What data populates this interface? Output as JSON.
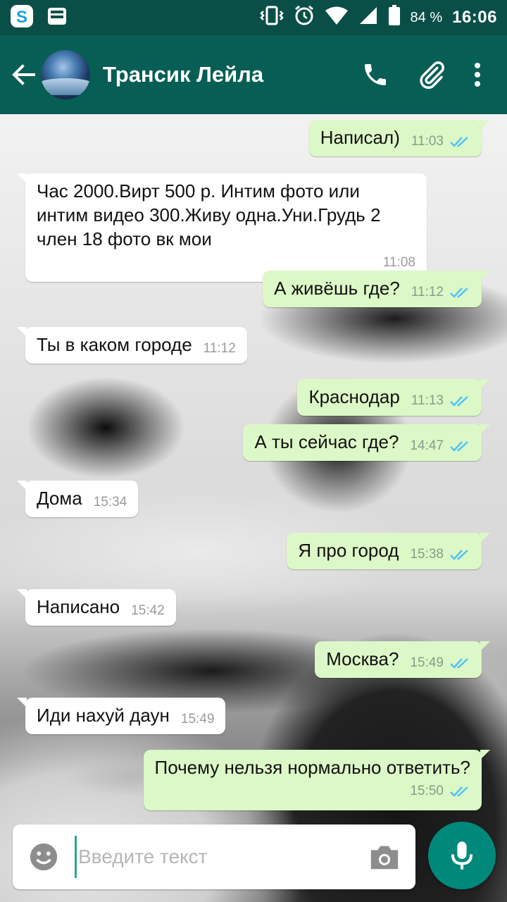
{
  "status_bar": {
    "battery_percent": "84 %",
    "time": "16:06"
  },
  "toolbar": {
    "contact_name": "Трансик Лейла"
  },
  "messages": [
    {
      "direction": "out",
      "text": "Написал)",
      "time": "11:03"
    },
    {
      "direction": "in",
      "text": "Час 2000.Вирт 500 р. Интим фото или интим видео 300.Живу одна.Уни.Грудь 2 член 18 фото вк мои",
      "time": "11:08"
    },
    {
      "direction": "out",
      "text": "А живёшь где?",
      "time": "11:12"
    },
    {
      "direction": "in",
      "text": "Ты в каком городе",
      "time": "11:12"
    },
    {
      "direction": "out",
      "text": "Краснодар",
      "time": "11:13"
    },
    {
      "direction": "out",
      "text": "А ты сейчас где?",
      "time": "14:47"
    },
    {
      "direction": "in",
      "text": "Дома",
      "time": "15:34"
    },
    {
      "direction": "out",
      "text": "Я про город",
      "time": "15:38"
    },
    {
      "direction": "in",
      "text": "Написано",
      "time": "15:42"
    },
    {
      "direction": "out",
      "text": "Москва?",
      "time": "15:49"
    },
    {
      "direction": "in",
      "text": "Иди нахуй даун",
      "time": "15:49"
    },
    {
      "direction": "out",
      "text": "Почему нельзя нормально ответить?",
      "time": "15:50"
    }
  ],
  "composer": {
    "placeholder": "Введите текст"
  },
  "colors": {
    "status_bar": "#0a4f47",
    "toolbar": "#075e54",
    "outgoing_bubble": "#dcf8c6",
    "incoming_bubble": "#ffffff",
    "read_ticks": "#4fc3f7",
    "mic_button": "#00897b"
  }
}
